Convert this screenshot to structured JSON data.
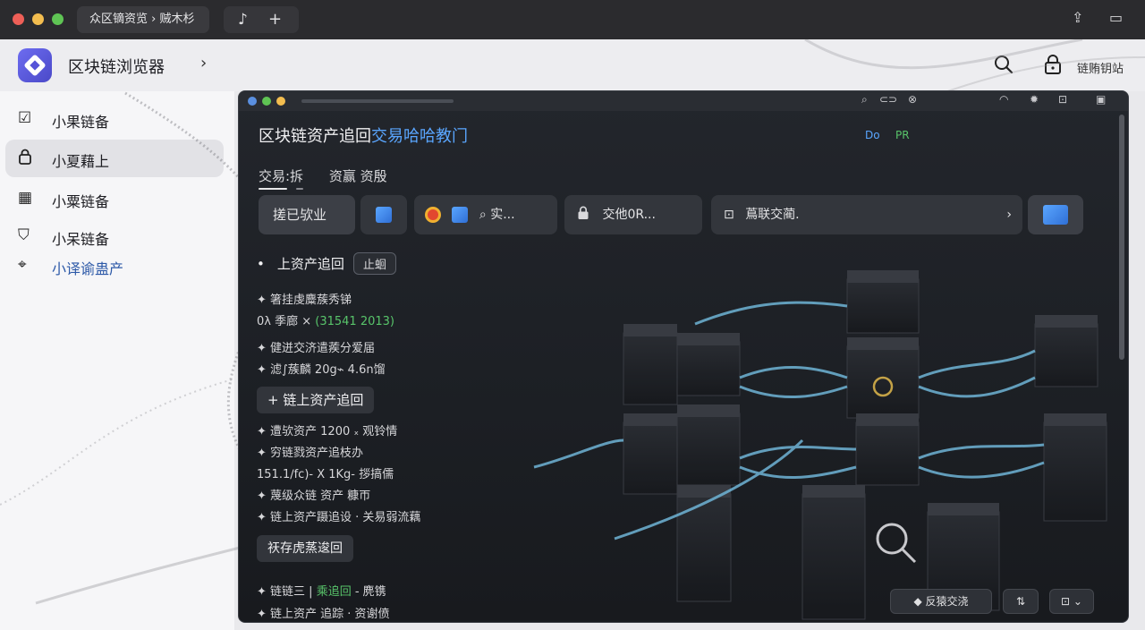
{
  "titlebar": {
    "tab_title": "众区镝资览 › 贼木杉",
    "new_tab": "+"
  },
  "header": {
    "app_title": "区块链浏览器",
    "right_text": "链贿钥站"
  },
  "sidebar": {
    "items": [
      {
        "label": "小果链备",
        "icon": "checkbox-icon",
        "blue": false
      },
      {
        "label": "小夏藉上",
        "icon": "lock-icon",
        "blue": false
      },
      {
        "label": "小粟链备",
        "icon": "grid-icon",
        "blue": false
      },
      {
        "label": "小呆链备",
        "icon": "shield-icon",
        "blue": false
      },
      {
        "label": "小译谕蛊产",
        "icon": "location-icon",
        "blue": true
      }
    ]
  },
  "panel": {
    "title_main": "区块链资产追回",
    "title_highlight": "交易哈哈教门",
    "badge_1": "Do",
    "badge_2": "PR",
    "tabs": [
      "交易:拆",
      "资赢 资殷"
    ],
    "toolbar": {
      "btn_1": "搓已欤业",
      "search_placeholder": "实...",
      "field_2": "交他0R...",
      "field_3": "蔦联交蔺."
    },
    "sections": {
      "s1_title": "上资产追回",
      "s1_pill": "止蛔",
      "s1_rows": [
        "✦ 箸挂虔麋蔟秀锑",
        "✦ 健迸交济遣蒺分爱届",
        "✦ 滤∫蔟麟 20g⌁ 4.6n馏"
      ],
      "s1_stat_prefix": "0λ 季廊 ×",
      "s1_stat_value": "(31541 2013)",
      "s2_title": "+ 链上资产追回",
      "s2_rows": [
        "✦ 遭欤资产 1200 ₓ 观铃情",
        "✦ 穷链戮资产追枝办",
        "151.1∕fc)- X 1Kg- 拶搞儒",
        "✦ 蔑级众链 资产 糠帀",
        "✦ 链上资产蹑追设 · 关易弱流藕"
      ],
      "s3_button": "祆存虎蒸逡回",
      "s3_row_prefix": "✦ 链链三 |",
      "s3_row_green": "乘追回",
      "s3_row_suffix": "- 麂镌",
      "s3_row_last": "✦ 链上资产 追踪 · 资谢偾"
    },
    "bottom": {
      "btn_1": "◆ 反猿交浇",
      "btn_2": "⇅",
      "btn_3": "⊡ ⌄"
    }
  }
}
